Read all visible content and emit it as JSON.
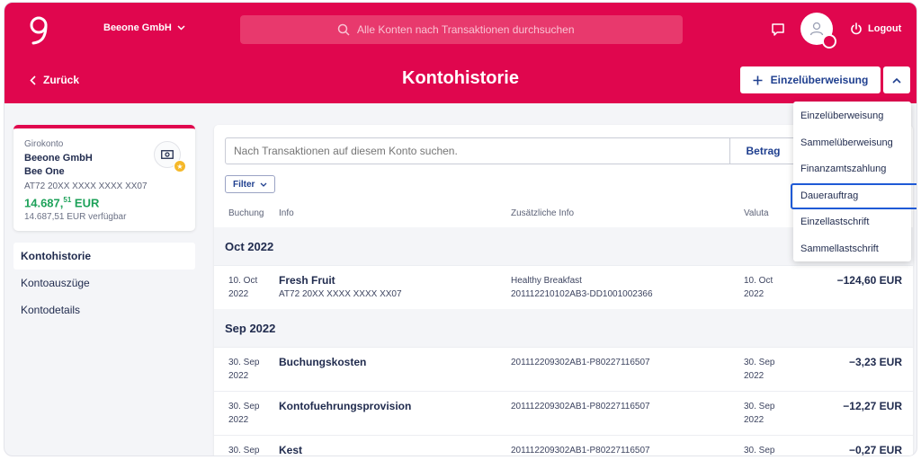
{
  "header": {
    "company": "Beeone GmbH",
    "search_placeholder": "Alle Konten nach Transaktionen durchsuchen",
    "logout": "Logout"
  },
  "subheader": {
    "back": "Zurück",
    "title": "Kontohistorie",
    "transfer_button": "Einzelüberweisung"
  },
  "account": {
    "type": "Girokonto",
    "name_line1": "Beeone GmbH",
    "name_line2": "Bee One",
    "iban": "AT72 20XX XXXX XXXX XX07",
    "balance_main": "14.687,",
    "balance_cents": "51",
    "balance_currency": " EUR",
    "available": "14.687,51 EUR verfügbar"
  },
  "sidebar": {
    "items": [
      {
        "label": "Kontohistorie"
      },
      {
        "label": "Kontoauszüge"
      },
      {
        "label": "Kontodetails"
      }
    ]
  },
  "main": {
    "search_placeholder": "Nach Transaktionen auf diesem Konto suchen.",
    "amount_button": "Betrag",
    "filter_button": "Filter",
    "columns": {
      "booking": "Buchung",
      "info": "Info",
      "extra": "Zusätzliche Info",
      "valuta": "Valuta"
    },
    "groups": [
      {
        "label": "Oct 2022",
        "rows": [
          {
            "date1": "10. Oct",
            "date2": "2022",
            "title": "Fresh Fruit",
            "sub": "AT72 20XX XXXX XXXX XX07",
            "extra1": "Healthy Breakfast",
            "extra2": "201112210102AB3-DD1001002366",
            "val1": "10. Oct",
            "val2": "2022",
            "amount": "−124,60 EUR"
          }
        ]
      },
      {
        "label": "Sep 2022",
        "rows": [
          {
            "date1": "30. Sep",
            "date2": "2022",
            "title": "Buchungskosten",
            "sub": "",
            "extra1": "201112209302AB1-P80227116507",
            "extra2": "",
            "val1": "30. Sep",
            "val2": "2022",
            "amount": "−3,23 EUR"
          },
          {
            "date1": "30. Sep",
            "date2": "2022",
            "title": "Kontofuehrungsprovision",
            "sub": "",
            "extra1": "201112209302AB1-P80227116507",
            "extra2": "",
            "val1": "30. Sep",
            "val2": "2022",
            "amount": "−12,27 EUR"
          },
          {
            "date1": "30. Sep",
            "date2": "",
            "title": "Kest",
            "sub": "",
            "extra1": "201112209302AB1-P80227116507",
            "extra2": "",
            "val1": "30. Sep",
            "val2": "",
            "amount": "−0,27 EUR"
          }
        ]
      }
    ]
  },
  "dropdown": {
    "items": [
      {
        "label": "Einzelüberweisung"
      },
      {
        "label": "Sammelüberweisung"
      },
      {
        "label": "Finanzamtszahlung"
      },
      {
        "label": "Dauerauftrag"
      },
      {
        "label": "Einzellastschrift"
      },
      {
        "label": "Sammellastschrift"
      }
    ],
    "highlighted": "Dauerauftrag"
  },
  "colors": {
    "brand": "#e0064e",
    "accent_blue": "#1f3f8f",
    "positive": "#1ea25a",
    "highlight": "#1f5ad6"
  },
  "icons": [
    "logo",
    "chevron-down-icon",
    "search-icon",
    "chat-icon",
    "user-icon",
    "power-icon",
    "chevron-left-icon",
    "plus-icon",
    "chevron-up-icon",
    "banknote-icon",
    "star-icon"
  ]
}
